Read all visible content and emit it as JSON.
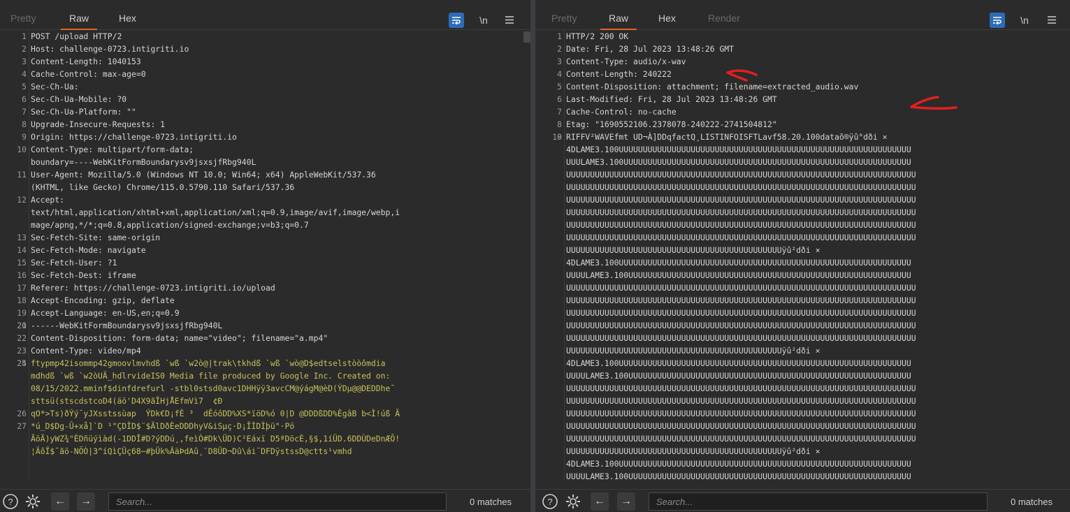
{
  "left": {
    "tabs": [
      {
        "label": "Pretty",
        "state": "dim"
      },
      {
        "label": "Raw",
        "state": "active"
      },
      {
        "label": "Hex",
        "state": "normal"
      }
    ],
    "toolbar": {
      "newline_label": "\\n"
    },
    "lines": [
      {
        "n": "1",
        "t": "POST /upload HTTP/2"
      },
      {
        "n": "2",
        "t": "Host: challenge-0723.intigriti.io"
      },
      {
        "n": "3",
        "t": "Content-Length: 1040153"
      },
      {
        "n": "4",
        "t": "Cache-Control: max-age=0"
      },
      {
        "n": "5",
        "t": "Sec-Ch-Ua:"
      },
      {
        "n": "6",
        "t": "Sec-Ch-Ua-Mobile: ?0"
      },
      {
        "n": "7",
        "t": "Sec-Ch-Ua-Platform: \"\""
      },
      {
        "n": "8",
        "t": "Upgrade-Insecure-Requests: 1"
      },
      {
        "n": "9",
        "t": "Origin: https://challenge-0723.intigriti.io"
      },
      {
        "n": "10",
        "t": "Content-Type: multipart/form-data;"
      },
      {
        "n": "",
        "t": "boundary=----WebKitFormBoundarysv9jsxsjfRbg940L"
      },
      {
        "n": "11",
        "t": "User-Agent: Mozilla/5.0 (Windows NT 10.0; Win64; x64) AppleWebKit/537.36"
      },
      {
        "n": "",
        "t": "(KHTML, like Gecko) Chrome/115.0.5790.110 Safari/537.36"
      },
      {
        "n": "12",
        "t": "Accept:"
      },
      {
        "n": "",
        "t": "text/html,application/xhtml+xml,application/xml;q=0.9,image/avif,image/webp,i"
      },
      {
        "n": "",
        "t": "mage/apng,*/*;q=0.8,application/signed-exchange;v=b3;q=0.7"
      },
      {
        "n": "13",
        "t": "Sec-Fetch-Site: same-origin"
      },
      {
        "n": "14",
        "t": "Sec-Fetch-Mode: navigate"
      },
      {
        "n": "15",
        "t": "Sec-Fetch-User: ?1"
      },
      {
        "n": "16",
        "t": "Sec-Fetch-Dest: iframe"
      },
      {
        "n": "17",
        "t": "Referer: https://challenge-0723.intigriti.io/upload"
      },
      {
        "n": "18",
        "t": "Accept-Encoding: gzip, deflate"
      },
      {
        "n": "19",
        "t": "Accept-Language: en-US,en;q=0.9"
      },
      {
        "n": "20",
        "t": ""
      },
      {
        "n": "21",
        "t": "------WebKitFormBoundarysv9jsxsjfRbg940L"
      },
      {
        "n": "22",
        "t": "Content-Disposition: form-data; name=\"video\"; filename=\"a.mp4\""
      },
      {
        "n": "23",
        "t": "Content-Type: video/mp4"
      },
      {
        "n": "24",
        "t": ""
      },
      {
        "n": "25",
        "t": "ftypmp42isommp42gmoovlmvhdß `wß `w2ò@|trak\\tkhdß `wß `wò@D$edtselstòòômdia",
        "bin": true
      },
      {
        "n": "",
        "t": "mdhdß `wß `w2òUÄ_hdlrvideIS0 Media file produced by Google Inc. Created on:",
        "bin": true
      },
      {
        "n": "",
        "t": "08/15/2022.mminf$dinfdrefurl -stbl0stsd0avc1DHHÿÿ3avcCM@ýágM@èD(ÝDµ@@DEDDhe¯",
        "bin": true
      },
      {
        "n": "",
        "t": "sttsü(stscdstcoD4(äö'D4X9ãÎHjÅEfmVì7  ¢Ð",
        "bin": true
      },
      {
        "n": "26",
        "t": "qO*>Ts)ðÝý¯yJXsstssùap  ÝDk€D¡fÈ ³  dÊóôDD%XS*ïöD%ó 0|D @DDDßDD%ÈgâB b<Ì!úß Ä",
        "bin": true
      },
      {
        "n": "27",
        "t": "*ú_D$Dg-Û+xå]`D ¹\"ÇDÌD$¨$ÃlDðÈeDDDhyV&iSµç·D¡ÎÌDÌþü\"·Pö",
        "bin": true
      },
      {
        "n": "",
        "t": "ÃöÃ)yWZ¾\"ÈDñüýìàd(-1DDÎ#D?ýDDú¸,feìÒ#Dk\\ÜD)C²Eáxï D5ªDöcÈ,§$,1íÜD.6DDÙDeDnÆÕ!",
        "bin": true
      },
      {
        "n": "",
        "t": "¦ÄôÏ$¯ãö-NÕÒ|3^íQìÇÜç68~#þÜk%ÂäÞdAû¸¨D8ÜD¬Dû\\ái¯DFDÿstssD@ctts¹vmhd",
        "bin": true
      }
    ],
    "search_placeholder": "Search...",
    "matches": "0 matches"
  },
  "right": {
    "tabs": [
      {
        "label": "Pretty",
        "state": "dim"
      },
      {
        "label": "Raw",
        "state": "active"
      },
      {
        "label": "Hex",
        "state": "normal"
      },
      {
        "label": "Render",
        "state": "dim"
      }
    ],
    "toolbar": {
      "newline_label": "\\n"
    },
    "lines": [
      {
        "n": "1",
        "t": "HTTP/2 200 OK"
      },
      {
        "n": "2",
        "t": "Date: Fri, 28 Jul 2023 13:48:26 GMT"
      },
      {
        "n": "3",
        "t": "Content-Type: audio/x-wav"
      },
      {
        "n": "4",
        "t": "Content-Length: 240222"
      },
      {
        "n": "5",
        "t": "Content-Disposition: attachment; filename=extracted_audio.wav"
      },
      {
        "n": "6",
        "t": "Last-Modified: Fri, 28 Jul 2023 13:48:26 GMT"
      },
      {
        "n": "7",
        "t": "Cache-Control: no-cache"
      },
      {
        "n": "8",
        "t": "Etag: \"1690552106.2378078-240222-2741504812\""
      },
      {
        "n": "9",
        "t": ""
      },
      {
        "n": "10",
        "t": "RIFFV²WAVEfmt UD¬À]DDqfactQ¸LISTINFOISFTLavf58.20.100dataõ®ÿû°dði ×"
      },
      {
        "n": "",
        "t": "4DLAME3.100UUUUUUUUUUUUUUUUUUUUUUUUUUUUUUUUUUUUUUUUUUUUUUUUUUUUUUUUUUUUU"
      },
      {
        "n": "",
        "t": "UUULAME3.100UUUUUUUUUUUUUUUUUUUUUUUUUUUUUUUUUUUUUUUUUUUUUUUUUUUUUUUUUUUU"
      },
      {
        "n": "",
        "t": "UUUUUUUUUUUUUUUUUUUUUUUUUUUUUUUUUUUUUUUUUUUUUUUUUUUUUUUUUUUUUUUUUUUUUUUUU"
      },
      {
        "n": "",
        "t": "UUUUUUUUUUUUUUUUUUUUUUUUUUUUUUUUUUUUUUUUUUUUUUUUUUUUUUUUUUUUUUUUUUUUUUUUU"
      },
      {
        "n": "",
        "t": "UUUUUUUUUUUUUUUUUUUUUUUUUUUUUUUUUUUUUUUUUUUUUUUUUUUUUUUUUUUUUUUUUUUUUUUUU"
      },
      {
        "n": "",
        "t": "UUUUUUUUUUUUUUUUUUUUUUUUUUUUUUUUUUUUUUUUUUUUUUUUUUUUUUUUUUUUUUUUUUUUUUUUU"
      },
      {
        "n": "",
        "t": "UUUUUUUUUUUUUUUUUUUUUUUUUUUUUUUUUUUUUUUUUUUUUUUUUUUUUUUUUUUUUUUUUUUUUUUUU"
      },
      {
        "n": "",
        "t": "UUUUUUUUUUUUUUUUUUUUUUUUUUUUUUUUUUUUUUUUUUUUUUUUUUUUUUUUUUUUUUUUUUUUUUUUU"
      },
      {
        "n": "",
        "t": "UUUUUUUUUUUUUUUUUUUUUUUUUUUUUUUUUUUUUUUUUUUUUÿû²dði ×"
      },
      {
        "n": "",
        "t": "4DLAME3.100UUUUUUUUUUUUUUUUUUUUUUUUUUUUUUUUUUUUUUUUUUUUUUUUUUUUUUUUUUUUU"
      },
      {
        "n": "",
        "t": "UUUULAME3.100UUUUUUUUUUUUUUUUUUUUUUUUUUUUUUUUUUUUUUUUUUUUUUUUUUUUUUUUUUU"
      },
      {
        "n": "",
        "t": "UUUUUUUUUUUUUUUUUUUUUUUUUUUUUUUUUUUUUUUUUUUUUUUUUUUUUUUUUUUUUUUUUUUUUUUUU"
      },
      {
        "n": "",
        "t": "UUUUUUUUUUUUUUUUUUUUUUUUUUUUUUUUUUUUUUUUUUUUUUUUUUUUUUUUUUUUUUUUUUUUUUUUU"
      },
      {
        "n": "",
        "t": "UUUUUUUUUUUUUUUUUUUUUUUUUUUUUUUUUUUUUUUUUUUUUUUUUUUUUUUUUUUUUUUUUUUUUUUUU"
      },
      {
        "n": "",
        "t": "UUUUUUUUUUUUUUUUUUUUUUUUUUUUUUUUUUUUUUUUUUUUUUUUUUUUUUUUUUUUUUUUUUUUUUUUU"
      },
      {
        "n": "",
        "t": "UUUUUUUUUUUUUUUUUUUUUUUUUUUUUUUUUUUUUUUUUUUUUUUUUUUUUUUUUUUUUUUUUUUUUUUUU"
      },
      {
        "n": "",
        "t": "UUUUUUUUUUUUUUUUUUUUUUUUUUUUUUUUUUUUUUUUUUUUUÿû²dði ×"
      },
      {
        "n": "",
        "t": "4DLAME3.100UUUUUUUUUUUUUUUUUUUUUUUUUUUUUUUUUUUUUUUUUUUUUUUUUUUUUUUUUUUUU"
      },
      {
        "n": "",
        "t": "UUUULAME3.100UUUUUUUUUUUUUUUUUUUUUUUUUUUUUUUUUUUUUUUUUUUUUUUUUUUUUUUUUUU"
      },
      {
        "n": "",
        "t": "UUUUUUUUUUUUUUUUUUUUUUUUUUUUUUUUUUUUUUUUUUUUUUUUUUUUUUUUUUUUUUUUUUUUUUUUU"
      },
      {
        "n": "",
        "t": "UUUUUUUUUUUUUUUUUUUUUUUUUUUUUUUUUUUUUUUUUUUUUUUUUUUUUUUUUUUUUUUUUUUUUUUUU"
      },
      {
        "n": "",
        "t": "UUUUUUUUUUUUUUUUUUUUUUUUUUUUUUUUUUUUUUUUUUUUUUUUUUUUUUUUUUUUUUUUUUUUUUUUU"
      },
      {
        "n": "",
        "t": "UUUUUUUUUUUUUUUUUUUUUUUUUUUUUUUUUUUUUUUUUUUUUUUUUUUUUUUUUUUUUUUUUUUUUUUUU"
      },
      {
        "n": "",
        "t": "UUUUUUUUUUUUUUUUUUUUUUUUUUUUUUUUUUUUUUUUUUUUUUUUUUUUUUUUUUUUUUUUUUUUUUUUU"
      },
      {
        "n": "",
        "t": "UUUUUUUUUUUUUUUUUUUUUUUUUUUUUUUUUUUUUUUUUUUUUÿû²dði ×"
      },
      {
        "n": "",
        "t": "4DLAME3.100UUUUUUUUUUUUUUUUUUUUUUUUUUUUUUUUUUUUUUUUUUUUUUUUUUUUUUUUUUUUU"
      },
      {
        "n": "",
        "t": "UUUULAME3.100UUUUUUUUUUUUUUUUUUUUUUUUUUUUUUUUUUUUUUUUUUUUUUUUUUUUUUUUUUU"
      }
    ],
    "search_placeholder": "Search...",
    "matches": "0 matches"
  },
  "colors": {
    "background": "#2b2b2b",
    "accent_tab": "#e8632b",
    "wrap_button": "#2e6bb8",
    "annotation": "#e02020",
    "binary_text": "#c8c05a"
  },
  "icons": [
    "wrap-lines-icon",
    "menu-icon",
    "help-icon",
    "settings-gear-icon",
    "arrow-left-icon",
    "arrow-right-icon"
  ]
}
